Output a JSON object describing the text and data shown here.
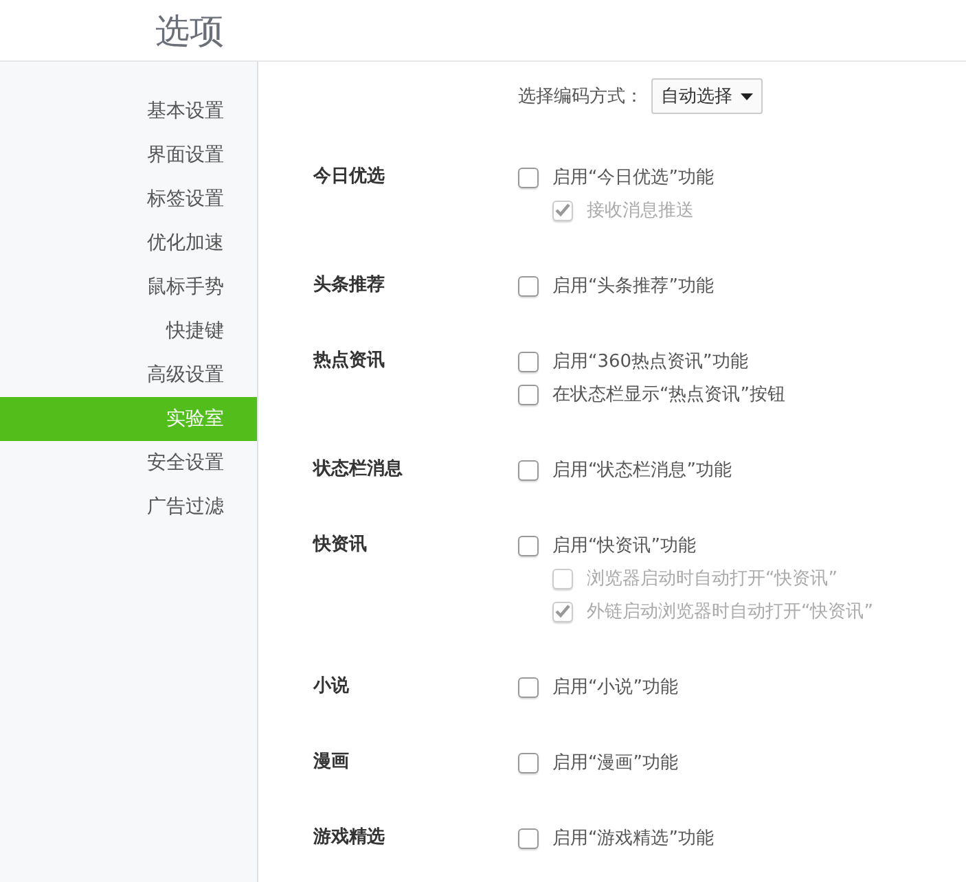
{
  "title": "选项",
  "sidebar": {
    "items": [
      {
        "label": "基本设置",
        "selected": false
      },
      {
        "label": "界面设置",
        "selected": false
      },
      {
        "label": "标签设置",
        "selected": false
      },
      {
        "label": "优化加速",
        "selected": false
      },
      {
        "label": "鼠标手势",
        "selected": false
      },
      {
        "label": "快捷键",
        "selected": false
      },
      {
        "label": "高级设置",
        "selected": false
      },
      {
        "label": "实验室",
        "selected": true
      },
      {
        "label": "安全设置",
        "selected": false
      },
      {
        "label": "广告过滤",
        "selected": false
      }
    ]
  },
  "encoding": {
    "label": "选择编码方式：",
    "value": "自动选择"
  },
  "sections": [
    {
      "label": "今日优选",
      "options": [
        {
          "text": "启用“今日优选”功能",
          "checked": false,
          "disabled": false,
          "children": [
            {
              "text": "接收消息推送",
              "checked": true,
              "disabled": true
            }
          ]
        }
      ]
    },
    {
      "label": "头条推荐",
      "options": [
        {
          "text": "启用“头条推荐”功能",
          "checked": false,
          "disabled": false
        }
      ]
    },
    {
      "label": "热点资讯",
      "options": [
        {
          "text": "启用“360热点资讯”功能",
          "checked": false,
          "disabled": false
        },
        {
          "text": "在状态栏显示“热点资讯”按钮",
          "checked": false,
          "disabled": false
        }
      ]
    },
    {
      "label": "状态栏消息",
      "options": [
        {
          "text": "启用“状态栏消息”功能",
          "checked": false,
          "disabled": false
        }
      ]
    },
    {
      "label": "快资讯",
      "options": [
        {
          "text": "启用“快资讯”功能",
          "checked": false,
          "disabled": false,
          "children": [
            {
              "text": "浏览器启动时自动打开“快资讯”",
              "checked": false,
              "disabled": true
            },
            {
              "text": "外链启动浏览器时自动打开“快资讯”",
              "checked": true,
              "disabled": true
            }
          ]
        }
      ]
    },
    {
      "label": "小说",
      "options": [
        {
          "text": "启用“小说”功能",
          "checked": false,
          "disabled": false
        }
      ]
    },
    {
      "label": "漫画",
      "options": [
        {
          "text": "启用“漫画”功能",
          "checked": false,
          "disabled": false
        }
      ]
    },
    {
      "label": "游戏精选",
      "options": [
        {
          "text": "启用“游戏精选”功能",
          "checked": false,
          "disabled": false
        }
      ]
    }
  ]
}
